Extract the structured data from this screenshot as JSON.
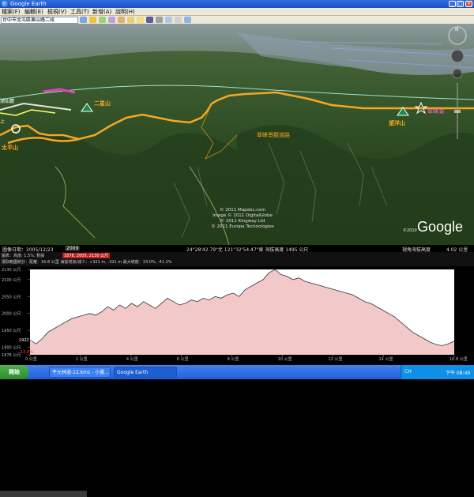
{
  "window": {
    "title": "Google Earth"
  },
  "menu": [
    "檔案(F)",
    "編輯(E)",
    "檢視(V)",
    "工具(T)",
    "新增(A)",
    "說明(H)"
  ],
  "toolbar": {
    "search_value": "台中市北屯區東山路二段"
  },
  "map_labels": {
    "ehr_san": "二星山",
    "wang_yang": "望洋山",
    "chui_feng_lake": "翠峰湖",
    "tai_ping": "太平山",
    "trail": "翠峰景觀道路",
    "left_edge_1": "湖仙麓",
    "left_edge_2": "上"
  },
  "attribution": [
    "© 2011 Mapabc.com",
    "Image © 2011 DigitalGlobe",
    "© 2011 Kingway Ltd",
    "© 2011 Europa Technologies"
  ],
  "google_logo": "Google",
  "google_year": "©2010",
  "status": {
    "imagery_date": "圖像日期：2005/12/23",
    "year": "2009",
    "coords": "24°28'42.79\"北 121°32'54.47\"東 海拔高度 1495 公尺",
    "eye_alt_label": "視角海拔高度",
    "eye_alt_value": "4.02 公里"
  },
  "profile_header": {
    "line1_a": "圖表：高度: 1.5%, 數據",
    "line1_b": "1878, 2005, 2130 公尺",
    "line2": "選取範圍統計：距離：16.8 公里 海拔增加/減少：+321 m, -321 m  最大坡度：33.0%, -41.2%"
  },
  "profile_axis": {
    "y_labels": [
      "2130 公尺",
      "2100 公尺",
      "2050 公尺",
      "2000 公尺",
      "1950 公尺",
      "1900 公尺",
      "1878 公尺"
    ],
    "x_labels": [
      "0 公里",
      "2 公里",
      "4 公里",
      "6 公里",
      "8 公里",
      "10 公里",
      "12 公里",
      "14 公里",
      "16.8 公里"
    ],
    "callout_value": "1922 公尺",
    "callout_slope": "13.0%"
  },
  "profile_elevation": [
    1922,
    1910,
    1925,
    1945,
    1955,
    1965,
    1975,
    1985,
    1990,
    1995,
    2000,
    1995,
    2005,
    2020,
    2010,
    2025,
    2015,
    2030,
    2020,
    2035,
    2025,
    2015,
    2030,
    2045,
    2035,
    2025,
    2030,
    2040,
    2035,
    2045,
    2040,
    2050,
    2045,
    2055,
    2060,
    2050,
    2070,
    2080,
    2090,
    2100,
    2120,
    2130,
    2115,
    2110,
    2100,
    2105,
    2095,
    2090,
    2085,
    2080,
    2075,
    2070,
    2065,
    2060,
    2055,
    2045,
    2035,
    2030,
    2020,
    2010,
    2000,
    1990,
    1975,
    1960,
    1945,
    1935,
    1925,
    1915,
    1908,
    1905,
    1910,
    1918
  ],
  "taskbar": {
    "start": "開始",
    "items": [
      "平元林道-12.kmz - 小畫...",
      "Google Earth"
    ],
    "lang": "CH",
    "clock": "下午 08:49"
  },
  "colors": {
    "track": "#f5a623",
    "profile_fill": "#f3c8c8",
    "magenta_track": "#e040c0"
  }
}
